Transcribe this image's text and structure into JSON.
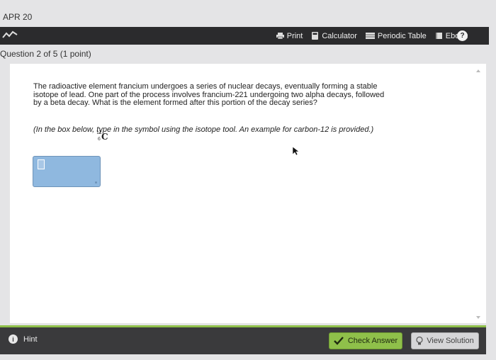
{
  "header": {
    "date": "APR 20"
  },
  "toolbar": {
    "print_label": "Print",
    "calculator_label": "Calculator",
    "periodic_table_label": "Periodic Table",
    "ebook_label": "Ebook",
    "help_glyph": "?"
  },
  "question": {
    "header": "Question 2 of 5 (1 point)",
    "text": "The radioactive element francium undergoes a series of nuclear decays, eventually forming a stable isotope of lead. One part of the process involves francium-221 undergoing two alpha decays, followed by a beta decay. What is the element formed after this portion of the decay series?",
    "instruction": "(In the box below, type in the symbol using the isotope tool. An example for carbon-12 is provided.)",
    "example_isotope": {
      "mass": "12",
      "atomic_number": "6",
      "symbol": "C"
    }
  },
  "footer": {
    "hint_label": "Hint",
    "check_answer_label": "Check Answer",
    "view_solution_label": "View Solution"
  },
  "colors": {
    "topbar": "#2b2b2d",
    "accent_green": "#8fc04a",
    "answer_box": "#8fb8df"
  }
}
